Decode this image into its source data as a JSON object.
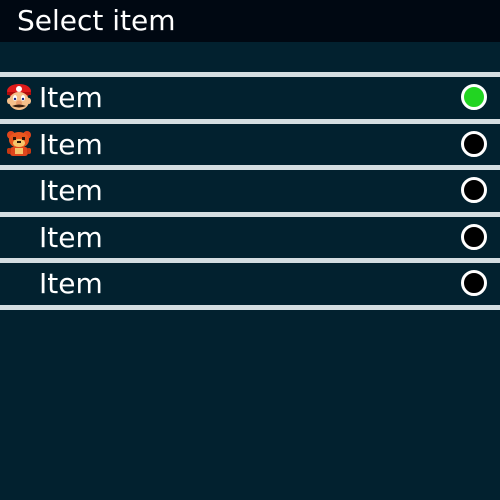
{
  "header": {
    "title": "Select item"
  },
  "items": [
    {
      "label": "Item",
      "icon": "mario-head-icon",
      "selected": true
    },
    {
      "label": "Item",
      "icon": "red-bear-icon",
      "selected": false
    },
    {
      "label": "Item",
      "icon": "",
      "selected": false
    },
    {
      "label": "Item",
      "icon": "",
      "selected": false
    },
    {
      "label": "Item",
      "icon": "",
      "selected": false
    }
  ],
  "colors": {
    "background": "#02212f",
    "titlebar": "#000812",
    "separator": "#d4dde1",
    "selected_radio": "#22d422"
  }
}
